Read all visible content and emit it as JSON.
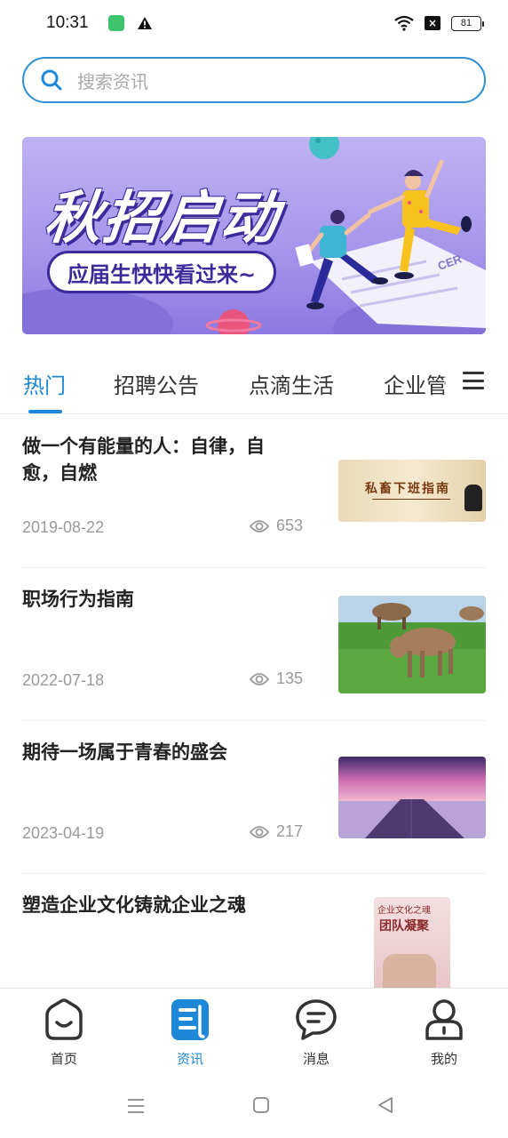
{
  "status_bar": {
    "time": "10:31",
    "battery": "81",
    "icons": [
      "app-notification-icon",
      "warning-icon",
      "wifi-icon",
      "sim-off-icon",
      "battery-icon"
    ]
  },
  "search": {
    "placeholder": "搜索资讯",
    "icon": "search-icon"
  },
  "banner": {
    "title": "秋招启动",
    "subtitle": "应届生快快看过来~",
    "badge_text": "CER"
  },
  "tabs": {
    "items": [
      {
        "label": "热门",
        "active": true
      },
      {
        "label": "招聘公告",
        "active": false
      },
      {
        "label": "点滴生活",
        "active": false
      },
      {
        "label": "企业管",
        "active": false
      }
    ],
    "more_icon": "menu-icon"
  },
  "news": [
    {
      "title": "做一个有能量的人：自律，自愈，自燃",
      "date": "2019-08-22",
      "views": "653",
      "thumb_title": "私畜下班指南"
    },
    {
      "title": "职场行为指南",
      "date": "2022-07-18",
      "views": "135"
    },
    {
      "title": "期待一场属于青春的盛会",
      "date": "2023-04-19",
      "views": "217"
    },
    {
      "title": "塑造企业文化铸就企业之魂",
      "thumb_top": "企业文化之魂",
      "thumb_title": "团队凝聚"
    }
  ],
  "bottom_nav": [
    {
      "label": "首页",
      "icon": "home-icon",
      "active": false
    },
    {
      "label": "资讯",
      "icon": "news-icon",
      "active": true
    },
    {
      "label": "消息",
      "icon": "message-icon",
      "active": false
    },
    {
      "label": "我的",
      "icon": "profile-icon",
      "active": false
    }
  ],
  "colors": {
    "accent": "#1e88d8",
    "banner": "#a796ec",
    "text": "#222222",
    "muted": "#9a9a9a"
  }
}
